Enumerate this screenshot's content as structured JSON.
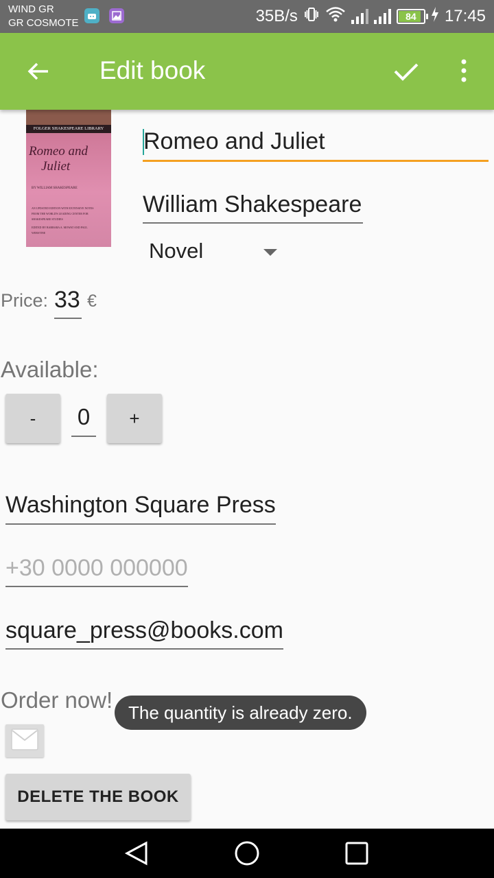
{
  "status_bar": {
    "carrier_line1": "WIND GR",
    "carrier_line2": "GR COSMOTE",
    "net_speed": "35B/s",
    "battery": "84",
    "time": "17:45",
    "icons": [
      "android-app-icon",
      "gallery-app-icon",
      "vibrate-icon",
      "wifi-icon",
      "signal-icon",
      "signal-icon",
      "battery-icon",
      "charging-icon"
    ]
  },
  "app_bar": {
    "title": "Edit book",
    "color": "#8bc34a",
    "icons": [
      "back-arrow-icon",
      "check-icon",
      "more-vert-icon"
    ]
  },
  "cover": {
    "library": "FOLGER SHAKESPEARE LIBRARY",
    "title_line1": "Romeo and",
    "title_line2": "Juliet",
    "author": "BY WILLIAM SHAKESPEARE",
    "blurb": "AN UPDATED EDITION WITH EXTENSIVE NOTES FROM THE WORLD'S LEADING CENTER FOR SHAKESPEARE STUDIES",
    "editors": "EDITED BY BARBARA A. MOWAT AND PAUL WERSTINE"
  },
  "form": {
    "title_value": "Romeo and Juliet",
    "author_value": "William Shakespeare",
    "genre_selected": "Novel",
    "price_label": "Price:",
    "price_value": "33",
    "currency": "€",
    "available_label": "Available:",
    "minus_label": "-",
    "quantity": "0",
    "plus_label": "+",
    "publisher_value": "Washington Square Press",
    "phone_placeholder": "+30 0000 000000",
    "email_value": "square_press@books.com",
    "order_label": "Order now!",
    "delete_label": "DELETE THE BOOK"
  },
  "toast": {
    "message": "The quantity is already zero."
  },
  "nav_bar": {
    "icons": [
      "back-triangle-icon",
      "home-circle-icon",
      "recents-square-icon"
    ]
  },
  "colors": {
    "accent": "#f4a020",
    "cursor": "#26a69a"
  }
}
